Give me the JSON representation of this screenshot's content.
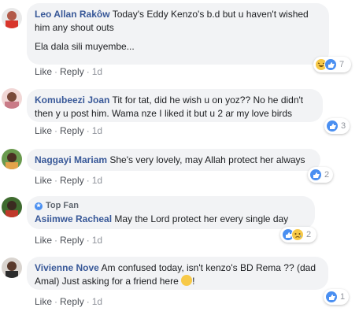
{
  "comments": [
    {
      "author": "Leo Allan Rakôw",
      "text_1": " Today's Eddy Kenzo's b.d but u haven't wished",
      "text_2": "him any shout outs",
      "text_3": "Ela dala sili muyembe...",
      "like": "Like",
      "reply": "Reply",
      "time": "1d",
      "reactions": {
        "icons": [
          "laugh-emoji-icon",
          "like-icon"
        ],
        "count": "7"
      }
    },
    {
      "author": "Komubeezi Joan",
      "text_1": " Tit for tat, did he wish u on yoz?? No he didn't",
      "text_2": "then y u post him. Wama nze I liked it but u 2 ar my love birds",
      "like": "Like",
      "reply": "Reply",
      "time": "1d",
      "reactions": {
        "icons": [
          "like-icon"
        ],
        "count": "3"
      }
    },
    {
      "author": "Naggayi Mariam",
      "text_1": " She's very lovely, may Allah protect her always",
      "like": "Like",
      "reply": "Reply",
      "time": "1d",
      "reactions": {
        "icons": [
          "like-icon"
        ],
        "count": "2"
      }
    },
    {
      "badge": "Top Fan",
      "author": "Asiimwe Racheal",
      "text_1": " May the Lord protect her every single day",
      "like": "Like",
      "reply": "Reply",
      "time": "1d",
      "reactions": {
        "icons": [
          "like-icon",
          "sad-emoji-icon"
        ],
        "count": "2"
      }
    },
    {
      "author": "Vivienne Nove",
      "text_1": " Am confused today, isn't kenzo's BD Rema ?? (dad",
      "text_2": "Amal) Just asking for a friend here ",
      "text_2_end": "!",
      "like": "Like",
      "reply": "Reply",
      "time": "1d",
      "reactions": {
        "icons": [
          "like-icon"
        ],
        "count": "1"
      }
    }
  ],
  "colors": {
    "author": "#385898",
    "bubble": "#f2f3f5",
    "meta": "#90949c",
    "like_blue": "#4a8ff1",
    "emoji_yellow": "#f7c948"
  }
}
